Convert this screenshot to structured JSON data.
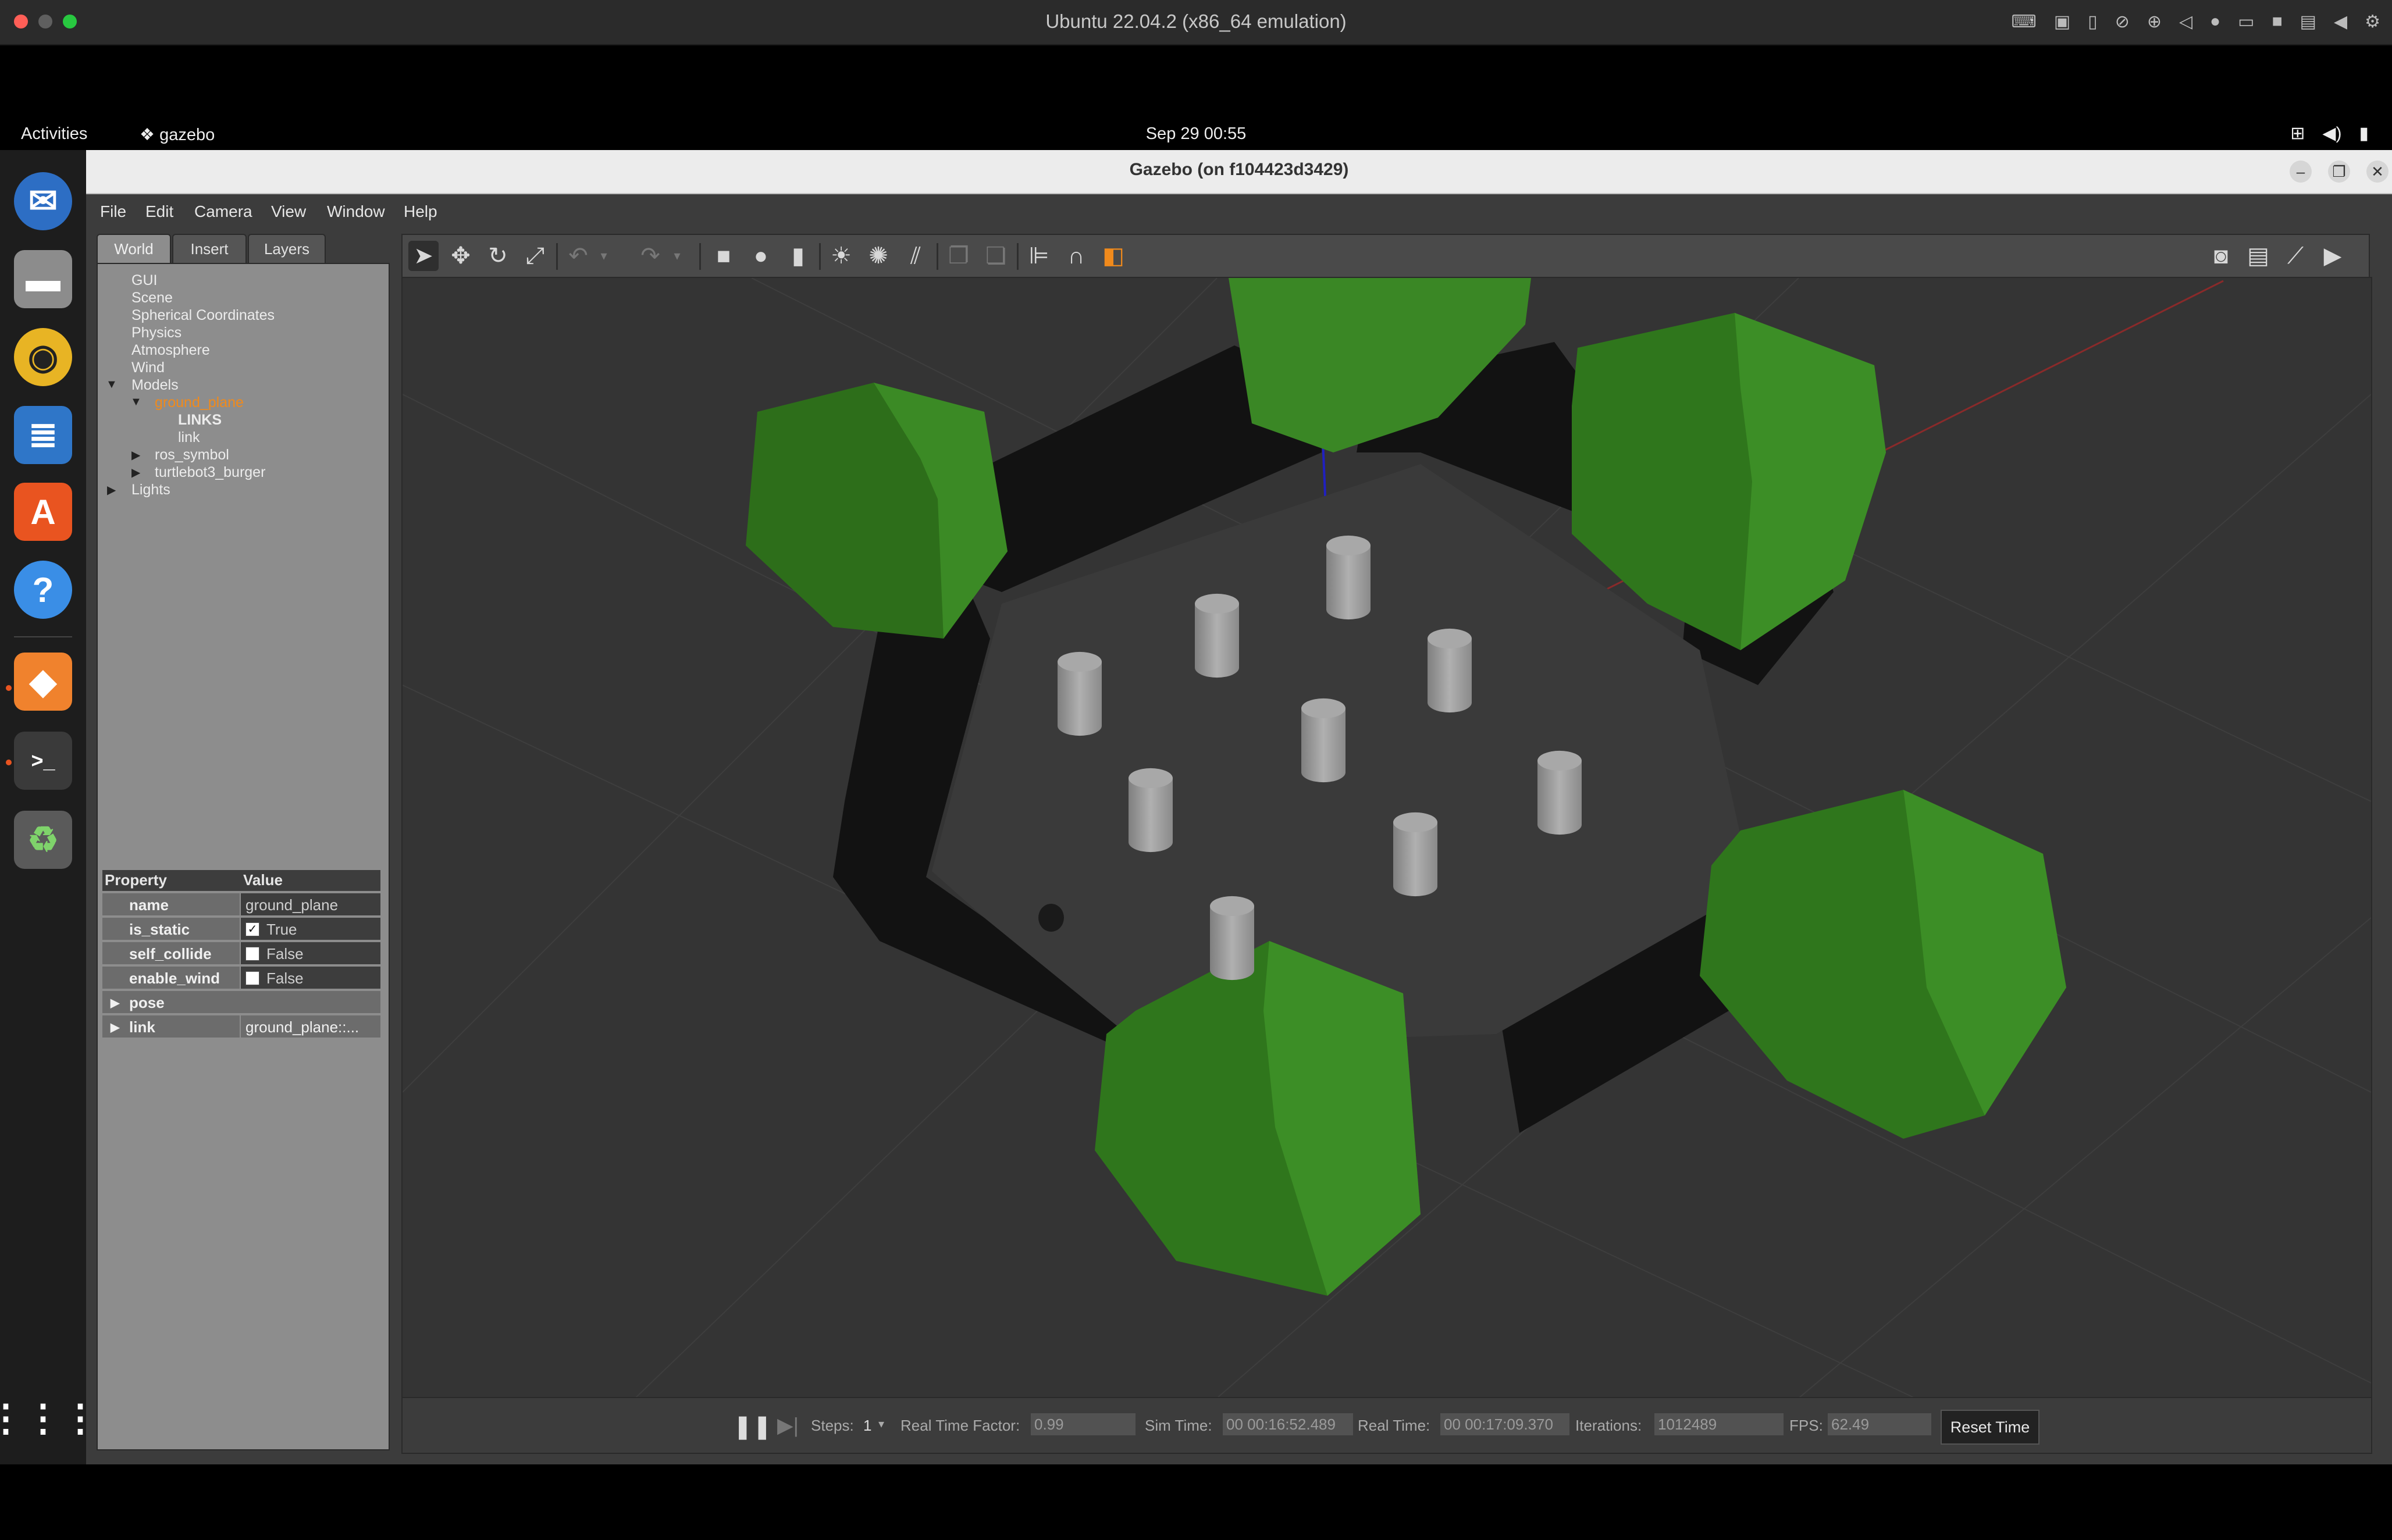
{
  "host": {
    "title": "Ubuntu 22.04.2 (x86_64 emulation)"
  },
  "topbar": {
    "activities": "Activities",
    "app_name": "gazebo",
    "clock": "Sep 29  00:55"
  },
  "dock": {
    "items": [
      "thunderbird-icon",
      "files-icon",
      "rhythmbox-icon",
      "writer-icon",
      "app-center-icon",
      "help-icon",
      "gazebo-icon",
      "terminal-icon",
      "trash-icon",
      "app-grid-icon"
    ]
  },
  "window": {
    "title": "Gazebo (on f104423d3429)",
    "menu": [
      "File",
      "Edit",
      "Camera",
      "View",
      "Window",
      "Help"
    ]
  },
  "left_panel": {
    "tabs": [
      "World",
      "Insert",
      "Layers"
    ],
    "tree": {
      "gui": "GUI",
      "scene": "Scene",
      "spherical": "Spherical Coordinates",
      "physics": "Physics",
      "atmosphere": "Atmosphere",
      "wind": "Wind",
      "models": "Models",
      "ground_plane": "ground_plane",
      "links_header": "LINKS",
      "link": "link",
      "ros_symbol": "ros_symbol",
      "turtlebot": "turtlebot3_burger",
      "lights": "Lights"
    },
    "properties": {
      "header_property": "Property",
      "header_value": "Value",
      "rows": [
        {
          "name": "name",
          "value": "ground_plane"
        },
        {
          "name": "is_static",
          "value": "True",
          "checked": true
        },
        {
          "name": "self_collide",
          "value": "False",
          "checked": false
        },
        {
          "name": "enable_wind",
          "value": "False",
          "checked": false
        },
        {
          "name": "pose",
          "value": ""
        },
        {
          "name": "link",
          "value": "ground_plane::..."
        }
      ]
    }
  },
  "status": {
    "steps_label": "Steps:",
    "steps_value": "1",
    "rtf_label": "Real Time Factor:",
    "rtf_value": "0.99",
    "sim_time_label": "Sim Time:",
    "sim_time_value": "00 00:16:52.489",
    "real_time_label": "Real Time:",
    "real_time_value": "00 00:17:09.370",
    "iterations_label": "Iterations:",
    "iterations_value": "1012489",
    "fps_label": "FPS:",
    "fps_value": "62.49",
    "reset_button": "Reset Time"
  },
  "colors": {
    "hex_green": "#2f7a1c",
    "wall": "#111111",
    "cylinder": "#9a9a9a",
    "selection": "#f08a1c"
  }
}
